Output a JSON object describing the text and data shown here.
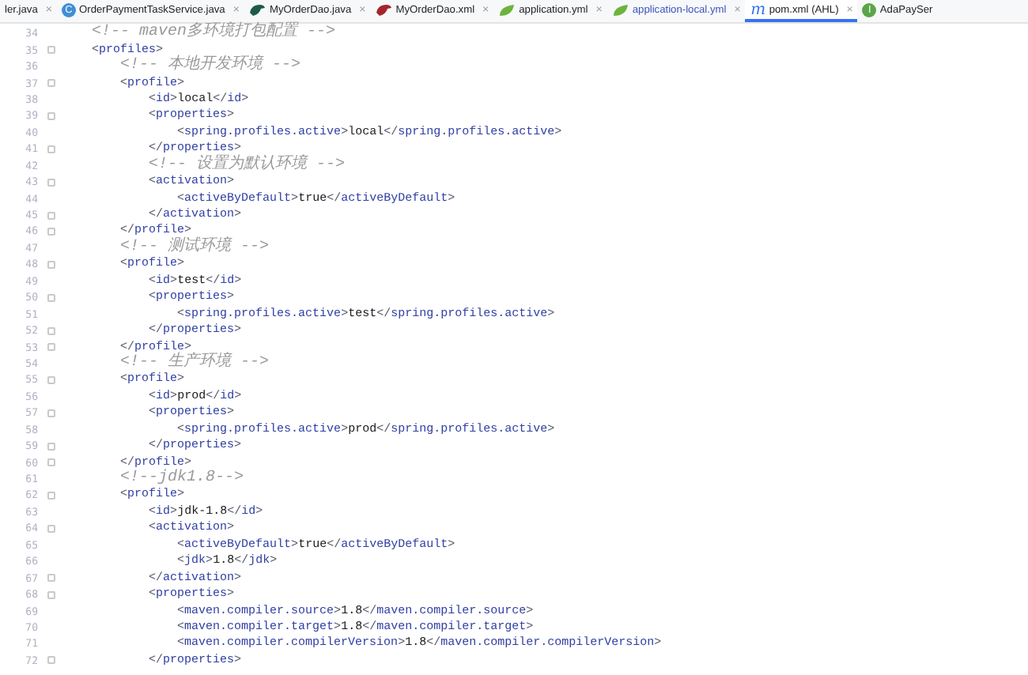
{
  "tabs": [
    {
      "label": "ler.java",
      "kind": "none",
      "selected": false,
      "modified": false,
      "closable": true
    },
    {
      "label": "OrderPaymentTaskService.java",
      "kind": "class",
      "badge": "C",
      "selected": false,
      "modified": false,
      "closable": true
    },
    {
      "label": "MyOrderDao.java",
      "kind": "mapper-java",
      "selected": false,
      "modified": false,
      "closable": true
    },
    {
      "label": "MyOrderDao.xml",
      "kind": "mapper-xml",
      "selected": false,
      "modified": false,
      "closable": true
    },
    {
      "label": "application.yml",
      "kind": "yaml",
      "selected": false,
      "modified": false,
      "closable": true
    },
    {
      "label": "application-local.yml",
      "kind": "yaml",
      "selected": false,
      "modified": true,
      "closable": true
    },
    {
      "label": "pom.xml (AHL)",
      "kind": "maven",
      "badge": "m",
      "selected": true,
      "modified": false,
      "closable": true
    },
    {
      "label": "AdaPaySer",
      "kind": "interface",
      "badge": "I",
      "selected": false,
      "modified": false,
      "closable": false
    }
  ],
  "close_glyph": "×",
  "editor": {
    "lines": [
      {
        "number": "34",
        "kind": "comment",
        "fold": false,
        "text": "    <!-- maven多环境打包配置 -->"
      },
      {
        "number": "35",
        "kind": "code",
        "fold": true,
        "text": "    <profiles>"
      },
      {
        "number": "36",
        "kind": "comment",
        "fold": false,
        "text": "        <!-- 本地开发环境 -->"
      },
      {
        "number": "37",
        "kind": "code",
        "fold": true,
        "text": "        <profile>"
      },
      {
        "number": "38",
        "kind": "code",
        "fold": false,
        "text": "            <id>local</id>"
      },
      {
        "number": "39",
        "kind": "code",
        "fold": true,
        "text": "            <properties>"
      },
      {
        "number": "40",
        "kind": "code",
        "fold": false,
        "text": "                <spring.profiles.active>local</spring.profiles.active>"
      },
      {
        "number": "41",
        "kind": "code",
        "fold": true,
        "text": "            </properties>"
      },
      {
        "number": "42",
        "kind": "comment",
        "fold": false,
        "text": "            <!-- 设置为默认环境 -->"
      },
      {
        "number": "43",
        "kind": "code",
        "fold": true,
        "text": "            <activation>"
      },
      {
        "number": "44",
        "kind": "code",
        "fold": false,
        "text": "                <activeByDefault>true</activeByDefault>"
      },
      {
        "number": "45",
        "kind": "code",
        "fold": true,
        "text": "            </activation>"
      },
      {
        "number": "46",
        "kind": "code",
        "fold": true,
        "text": "        </profile>"
      },
      {
        "number": "47",
        "kind": "comment",
        "fold": false,
        "text": "        <!-- 测试环境 -->"
      },
      {
        "number": "48",
        "kind": "code",
        "fold": true,
        "text": "        <profile>"
      },
      {
        "number": "49",
        "kind": "code",
        "fold": false,
        "text": "            <id>test</id>"
      },
      {
        "number": "50",
        "kind": "code",
        "fold": true,
        "text": "            <properties>"
      },
      {
        "number": "51",
        "kind": "code",
        "fold": false,
        "text": "                <spring.profiles.active>test</spring.profiles.active>"
      },
      {
        "number": "52",
        "kind": "code",
        "fold": true,
        "text": "            </properties>"
      },
      {
        "number": "53",
        "kind": "code",
        "fold": true,
        "text": "        </profile>"
      },
      {
        "number": "54",
        "kind": "comment",
        "fold": false,
        "text": "        <!-- 生产环境 -->"
      },
      {
        "number": "55",
        "kind": "code",
        "fold": true,
        "text": "        <profile>"
      },
      {
        "number": "56",
        "kind": "code",
        "fold": false,
        "text": "            <id>prod</id>"
      },
      {
        "number": "57",
        "kind": "code",
        "fold": true,
        "text": "            <properties>"
      },
      {
        "number": "58",
        "kind": "code",
        "fold": false,
        "text": "                <spring.profiles.active>prod</spring.profiles.active>"
      },
      {
        "number": "59",
        "kind": "code",
        "fold": true,
        "text": "            </properties>"
      },
      {
        "number": "60",
        "kind": "code",
        "fold": true,
        "text": "        </profile>"
      },
      {
        "number": "61",
        "kind": "comment",
        "fold": false,
        "text": "        <!--jdk1.8-->"
      },
      {
        "number": "62",
        "kind": "code",
        "fold": true,
        "text": "        <profile>"
      },
      {
        "number": "63",
        "kind": "code",
        "fold": false,
        "text": "            <id>jdk-1.8</id>"
      },
      {
        "number": "64",
        "kind": "code",
        "fold": true,
        "text": "            <activation>"
      },
      {
        "number": "65",
        "kind": "code",
        "fold": false,
        "text": "                <activeByDefault>true</activeByDefault>"
      },
      {
        "number": "66",
        "kind": "code",
        "fold": false,
        "text": "                <jdk>1.8</jdk>"
      },
      {
        "number": "67",
        "kind": "code",
        "fold": true,
        "text": "            </activation>"
      },
      {
        "number": "68",
        "kind": "code",
        "fold": true,
        "text": "            <properties>"
      },
      {
        "number": "69",
        "kind": "code",
        "fold": false,
        "text": "                <maven.compiler.source>1.8</maven.compiler.source>"
      },
      {
        "number": "70",
        "kind": "code",
        "fold": false,
        "text": "                <maven.compiler.target>1.8</maven.compiler.target>"
      },
      {
        "number": "71",
        "kind": "code",
        "fold": false,
        "text": "                <maven.compiler.compilerVersion>1.8</maven.compiler.compilerVersion>"
      },
      {
        "number": "72",
        "kind": "code",
        "fold": true,
        "text": "            </properties>"
      }
    ]
  }
}
